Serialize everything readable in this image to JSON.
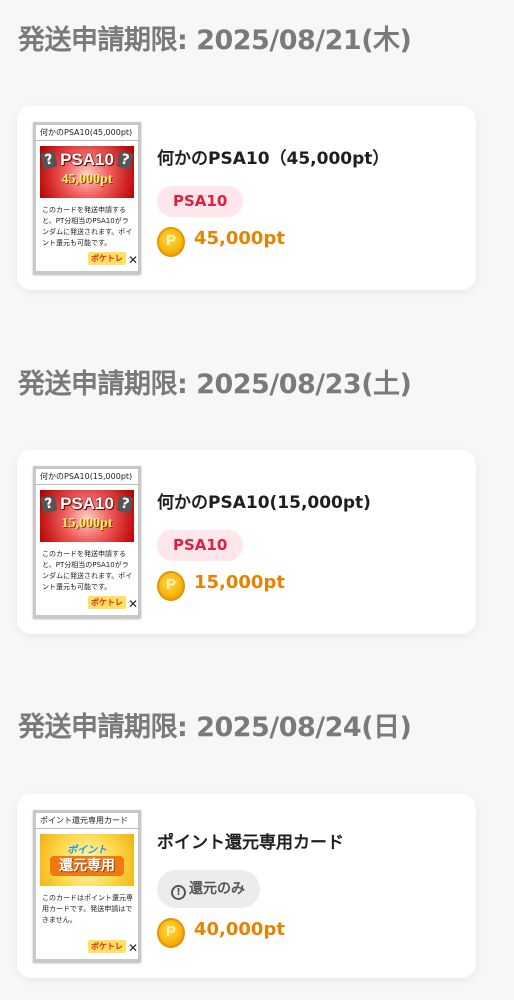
{
  "sections": [
    {
      "deadline": "発送申請期限: 2025/08/21(木)",
      "card": {
        "title": "何かのPSA10（45,000pt）",
        "tag": "PSA10",
        "points": "45,000pt",
        "thumb": {
          "header": "何かのPSA10(45,000pt)",
          "art_title": "PSA10",
          "art_sub": "45,000pt",
          "text": "このカードを発送申請すると、PT分相当のPSA10がランダムに発送されます。ポイント還元も可能です。",
          "logo": "ポケトレ"
        }
      }
    },
    {
      "deadline": "発送申請期限: 2025/08/23(土)",
      "card": {
        "title": "何かのPSA10(15,000pt)",
        "tag": "PSA10",
        "points": "15,000pt",
        "thumb": {
          "header": "何かのPSA10(15,000pt)",
          "art_title": "PSA10",
          "art_sub": "15,000pt",
          "text": "このカードを発送申請すると、PT分相当のPSA10がランダムに発送されます。ポイント還元も可能です。",
          "logo": "ポケトレ"
        }
      }
    },
    {
      "deadline": "発送申請期限: 2025/08/24(日)",
      "card": {
        "title": "ポイント還元専用カード",
        "tag": "還元のみ",
        "points": "40,000pt",
        "thumb": {
          "header": "ポイント還元専用カード",
          "art_top": "ポイント",
          "art_main": "還元専用",
          "text": "このカードはポイント還元専用カードです。発送申請はできません。",
          "logo": "ポケトレ"
        }
      }
    }
  ],
  "coin_letter": "P",
  "alert_glyph": "!",
  "colors": {
    "deadline": "#7a7a7a",
    "psa_tag_bg": "#ffe6ea",
    "psa_tag_text": "#e02040",
    "points": "#e68300",
    "return_tag_bg": "#ececec"
  },
  "icons": [
    "coin-icon",
    "alert-circle-icon",
    "question-card-icon"
  ]
}
